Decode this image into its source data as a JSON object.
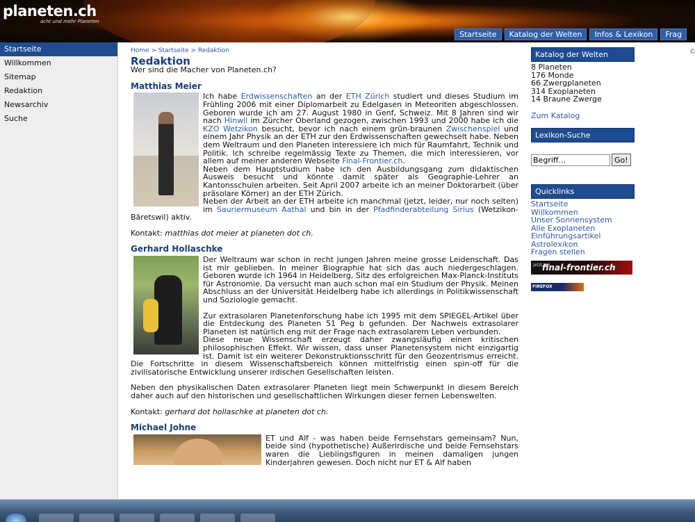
{
  "header": {
    "logo": "planeten.ch",
    "logo_sub": "acht und mehr Planeten",
    "nav": [
      "Startseite",
      "Katalog der Welten",
      "Infos & Lexikon",
      "Frag"
    ]
  },
  "sidebar": {
    "items": [
      {
        "label": "Startseite"
      },
      {
        "label": "Willkommen"
      },
      {
        "label": "Sitemap"
      },
      {
        "label": "Redaktion"
      },
      {
        "label": "Newsarchiv"
      },
      {
        "label": "Suche"
      }
    ]
  },
  "breadcrumb": {
    "home": "Home",
    "sep": " > ",
    "start": "Startseite",
    "current": "Redaktion"
  },
  "main": {
    "title": "Redaktion",
    "subtitle": "Wer sind die Macher von Planeten.ch?",
    "people": [
      {
        "name": "Matthias Meier",
        "bio1_a": "Ich habe ",
        "bio1_link1": "Erdwissenschaften",
        "bio1_b": " an der ",
        "bio1_link2": "ETH Zürich",
        "bio1_c": " studiert und dieses Studium im Frühling 2006 mit einer Diplomarbeit zu Edelgasen in Meteoriten abgeschlossen. Geboren wurde ich am 27. August 1980 in Genf, Schweiz. Mit 8 Jahren sind wir nach ",
        "bio1_link3": "Hinwil",
        "bio1_d": " im Zürcher Oberland gezogen, zwischen 1993 und 2000 habe ich die ",
        "bio1_link4": "KZO Wetzikon",
        "bio1_e": " besucht, bevor ich nach einem grün-braunen ",
        "bio1_link5": "Zwischenspiel",
        "bio1_f": " und einem Jahr Physik an der ETH zur den Erdwissenschaften gewechselt habe. Neben dem Weltraum und den Planeten interessiere ich mich für Raumfahrt, Technik und Politik. Ich schreibe regelmässig Texte zu Themen, die mich interessieren, vor allem auf meiner anderen Webseite ",
        "bio1_link6": "Final-Frontier.ch",
        "bio1_g": ".",
        "bio2": "Neben dem Hauptstudium habe ich den Ausbildungsgang zum didaktischen Ausweis besucht und könnte damit später als Geographie-Lehrer an Kantonsschulen arbeiten. Seit April 2007 arbeite ich an meiner Doktorarbeit (über präsolare Körner) an der ETH Zürich.",
        "bio3_a": "Neben der Arbeit an der ETH arbeite ich manchmal (jetzt, leider, nur noch selten) im ",
        "bio3_link1": "Sauriermuseum Aathal",
        "bio3_b": " und bin in der ",
        "bio3_link2": "Pfadfinderabteilung Sirius",
        "bio3_c": " (Wetzikon-Bäretswil) aktiv.",
        "contact_label": "Kontakt: ",
        "contact": "matthias dot meier at planeten dot ch."
      },
      {
        "name": "Gerhard Hollaschke",
        "bio1": "Der Weltraum war schon in recht jungen Jahren meine grosse Leidenschaft. Das ist mir geblieben. In meiner Biographie hat sich das auch niedergeschlagen. Geboren wurde ich 1964 in Heidelberg, Sitz des erfolgreichen Max-Planck-Instituts für Astronomie. Da versucht man auch schon mal ein Studium der Physik. Meinen Abschluss an der Universität Heidelberg habe ich allerdings in Politikwissenschaft und Soziologie gemacht.",
        "bio2": "Zur extrasolaren Planetenforschung habe ich 1995 mit dem SPIEGEL-Artikel über die Entdeckung des Planeten 51 Peg b gefunden. Der Nachweis extrasolarer Planeten ist natürlich eng mit der Frage nach extrasolarem Leben verbunden.",
        "bio3": "Diese neue Wissenschaft erzeugt daher zwangsläufig einen kritischen philosophischen Effekt. Wir wissen, dass unser Planetensystem nicht einzigartig ist. Damit ist ein weiterer Dekonstruktionsschritt für den Geozentrismus erreicht. Die Fortschritte in diesem Wissenschaftsbereich können mittelfristig einen spin-off für die zivilisatorische Entwicklung unserer irdischen Gesellschaften leisten.",
        "bio4": "Neben den physikalischen Daten extrasolarer Planeten liegt mein Schwerpunkt in diesem Bereich daher auch auf den historischen und gesellschaftlichen Wirkungen dieser fernen Lebenswelten.",
        "contact_label": "Kontakt: ",
        "contact": "gerhard dot hollaschke at planeten dot ch."
      },
      {
        "name": "Michael Johne",
        "bio1": "ET und Alf - was haben beide Fernsehstars gemeinsam? Nun, beide sind (hypothetische) Außerirdische und beide Fernsehstars waren die Lieblingsfiguren in meinen damaligen jungen Kinderjahren gewesen. Doch nicht nur ET & Alf haben"
      }
    ]
  },
  "right": {
    "catalog_title": "Katalog der Welten",
    "catalog_lines": [
      "8 Planeten",
      "176 Monde",
      "66 Zwergplaneten",
      "314 Exoplaneten",
      "14 Braune Zwerge"
    ],
    "catalog_link": "Zum Katalog",
    "lexikon_title": "Lexikon-Suche",
    "search_value": "Begriff...",
    "search_button": "Go!",
    "quick_title": "Quicklinks",
    "quicklinks": [
      "Startseite",
      "Willkommen",
      "Unser Sonnensystem",
      "Alle Exoplaneten",
      "Einführungsartikel",
      "Astrolexikon",
      "Fragen stellen"
    ],
    "banner1_small": "jetzt bei...",
    "banner1_big": "final-frontier.ch",
    "banner2": "FIREFOX"
  },
  "colors": {
    "accent": "#1f4b90",
    "link": "#2c57a8",
    "title": "#1a3c78"
  }
}
